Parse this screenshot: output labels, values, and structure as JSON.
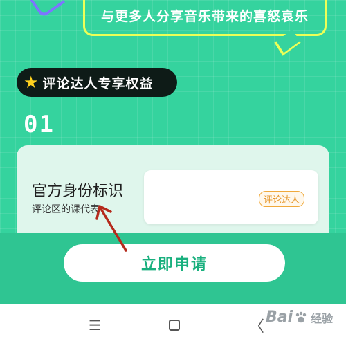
{
  "banner": {
    "bubble_text": "与更多人分享音乐带来的喜怒哀乐"
  },
  "benefit": {
    "pill_label": "评论达人专享权益",
    "star_icon": "★"
  },
  "step": {
    "number": "01"
  },
  "card": {
    "title": "官方身份标识",
    "subtitle": "评论区的课代表",
    "badge": "评论达人"
  },
  "apply_button": {
    "label": "立即申请"
  },
  "navbar": {
    "menu_icon": "☰",
    "back_icon": "〈"
  },
  "watermark": {
    "latin_a": "Bai",
    "latin_b": "",
    "cn": "经验"
  },
  "colors": {
    "background_green": "#35d39e",
    "button_text": "#19b07e",
    "badge_orange": "#f0a93b",
    "arrow_red": "#b52a1c"
  }
}
